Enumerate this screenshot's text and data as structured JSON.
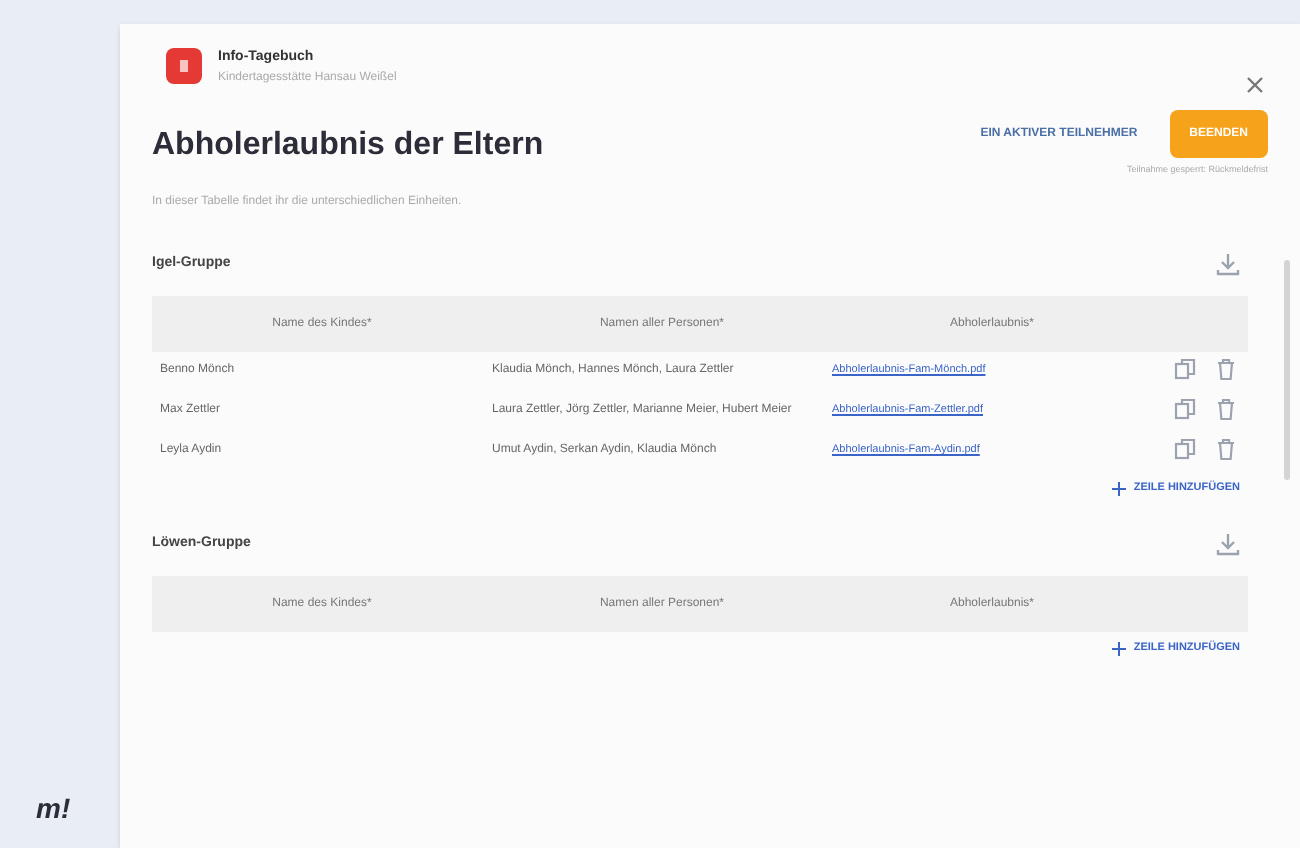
{
  "app": {
    "name": "Info-Tagebuch",
    "subtitle": "Kindertagesstätte Hansau Weißel",
    "logo_mark": "m!"
  },
  "page": {
    "title": "Abholerlaubnis der Eltern",
    "description": "In dieser Tabelle findet ihr die unterschiedlichen Einheiten.",
    "participants": "EIN AKTIVER TEILNEHMER",
    "end_button": "BEENDEN",
    "note": "Teilnahme gesperrt: Rückmeldefrist"
  },
  "groups": [
    {
      "name": "Igel-Gruppe",
      "columns": [
        "Name des Kindes*",
        "Namen aller Personen*",
        "Abholerlaubnis*"
      ],
      "rows": [
        {
          "child": "Benno Mönch",
          "persons": "Klaudia Mönch, Hannes Mönch, Laura Zettler",
          "file": "Abholerlaubnis-Fam-Mönch.pdf"
        },
        {
          "child": "Max Zettler",
          "persons": "Laura Zettler, Jörg Zettler, Marianne Meier, Hubert Meier",
          "file": "Abholerlaubnis-Fam-Zettler.pdf"
        },
        {
          "child": "Leyla Aydin",
          "persons": "Umut Aydin, Serkan Aydin, Klaudia Mönch",
          "file": "Abholerlaubnis-Fam-Aydin.pdf"
        }
      ],
      "add_row": "ZEILE HINZUFÜGEN"
    },
    {
      "name": "Löwen-Gruppe",
      "columns": [
        "Name des Kindes*",
        "Namen aller Personen*",
        "Abholerlaubnis*"
      ],
      "add_row": "ZEILE HINZUFÜGEN"
    }
  ]
}
